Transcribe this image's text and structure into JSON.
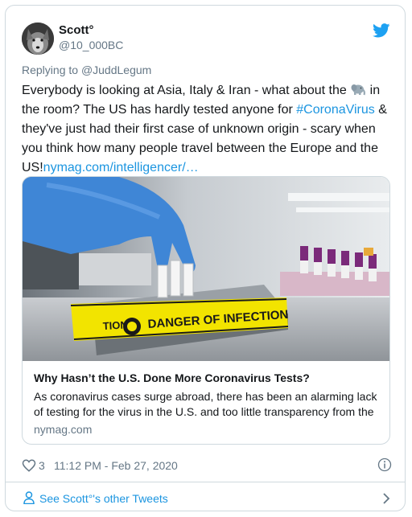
{
  "author": {
    "name": "Scott°",
    "handle": "@10_000BC",
    "avatar_icon": "wolf-avatar"
  },
  "brand": {
    "icon": "twitter-bird-icon",
    "color": "#1da1f2"
  },
  "reply": {
    "prefix": "Replying to ",
    "to": "@JuddLegum"
  },
  "tweet": {
    "text_1": "Everybody is looking at Asia, Italy & Iran - what about the ",
    "emoji": "elephant-emoji",
    "text_2": " in the room? The US has hardly tested anyone for ",
    "hashtag": "#CoronaVirus",
    "text_3": " & they've just had their first case of unknown origin - scary when you think how many people travel between the Europe and the US!",
    "link": "nymag.com/intelligencer/…"
  },
  "link_card": {
    "image_text": "DANGER OF INFECTION",
    "title": "Why Hasn’t the U.S. Done More Coronavirus Tests?",
    "description": "As coronavirus cases surge abroad, there has been an alarming lack of testing for the virus in the U.S. and too little transparency from the",
    "domain": "nymag.com"
  },
  "stats": {
    "likes": "3",
    "timestamp": "11:12 PM - Feb 27, 2020"
  },
  "footer": {
    "label": "See Scott°'s other Tweets"
  },
  "colors": {
    "link": "#1b95e0",
    "muted": "#657786",
    "text": "#14171a",
    "border": "#cfd9de"
  }
}
